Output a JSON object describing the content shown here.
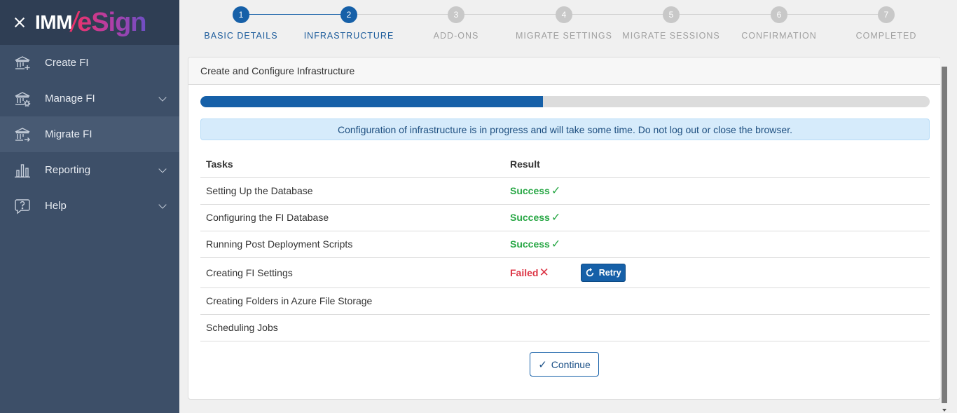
{
  "brand": {
    "part1": "IMM",
    "slash": "/",
    "part2": "eSign"
  },
  "sidebar": {
    "items": [
      {
        "label": "Create FI",
        "icon": "bank-plus-icon",
        "has_submenu": false,
        "active": false
      },
      {
        "label": "Manage FI",
        "icon": "bank-gear-icon",
        "has_submenu": true,
        "active": false
      },
      {
        "label": "Migrate FI",
        "icon": "bank-arrow-icon",
        "has_submenu": false,
        "active": true
      },
      {
        "label": "Reporting",
        "icon": "bar-chart-icon",
        "has_submenu": true,
        "active": false
      },
      {
        "label": "Help",
        "icon": "question-icon",
        "has_submenu": true,
        "active": false
      }
    ]
  },
  "stepper": {
    "steps": [
      {
        "number": "1",
        "label": "BASIC DETAILS",
        "state": "done"
      },
      {
        "number": "2",
        "label": "INFRASTRUCTURE",
        "state": "done"
      },
      {
        "number": "3",
        "label": "ADD-ONS",
        "state": "todo"
      },
      {
        "number": "4",
        "label": "MIGRATE SETTINGS",
        "state": "todo"
      },
      {
        "number": "5",
        "label": "MIGRATE SESSIONS",
        "state": "todo"
      },
      {
        "number": "6",
        "label": "CONFIRMATION",
        "state": "todo"
      },
      {
        "number": "7",
        "label": "COMPLETED",
        "state": "todo"
      }
    ]
  },
  "card": {
    "title": "Create and Configure Infrastructure",
    "progress_fraction": 0.47,
    "alert": "Configuration of infrastructure is in progress and will take some time. Do not log out or close the browser."
  },
  "table": {
    "headers": [
      "Tasks",
      "Result"
    ],
    "rows": [
      {
        "task": "Setting Up the Database",
        "result": "Success",
        "status": "success"
      },
      {
        "task": "Configuring the FI Database",
        "result": "Success",
        "status": "success"
      },
      {
        "task": "Running Post Deployment Scripts",
        "result": "Success",
        "status": "success"
      },
      {
        "task": "Creating FI Settings",
        "result": "Failed",
        "status": "failed"
      },
      {
        "task": "Creating Folders in Azure File Storage",
        "result": "",
        "status": "pending"
      },
      {
        "task": "Scheduling Jobs",
        "result": "",
        "status": "pending"
      }
    ],
    "retry_label": "Retry"
  },
  "continue_label": "Continue",
  "colors": {
    "primary": "#1660a8",
    "success": "#28a745",
    "danger": "#dc3545",
    "sidebar": "#3d4f68"
  }
}
